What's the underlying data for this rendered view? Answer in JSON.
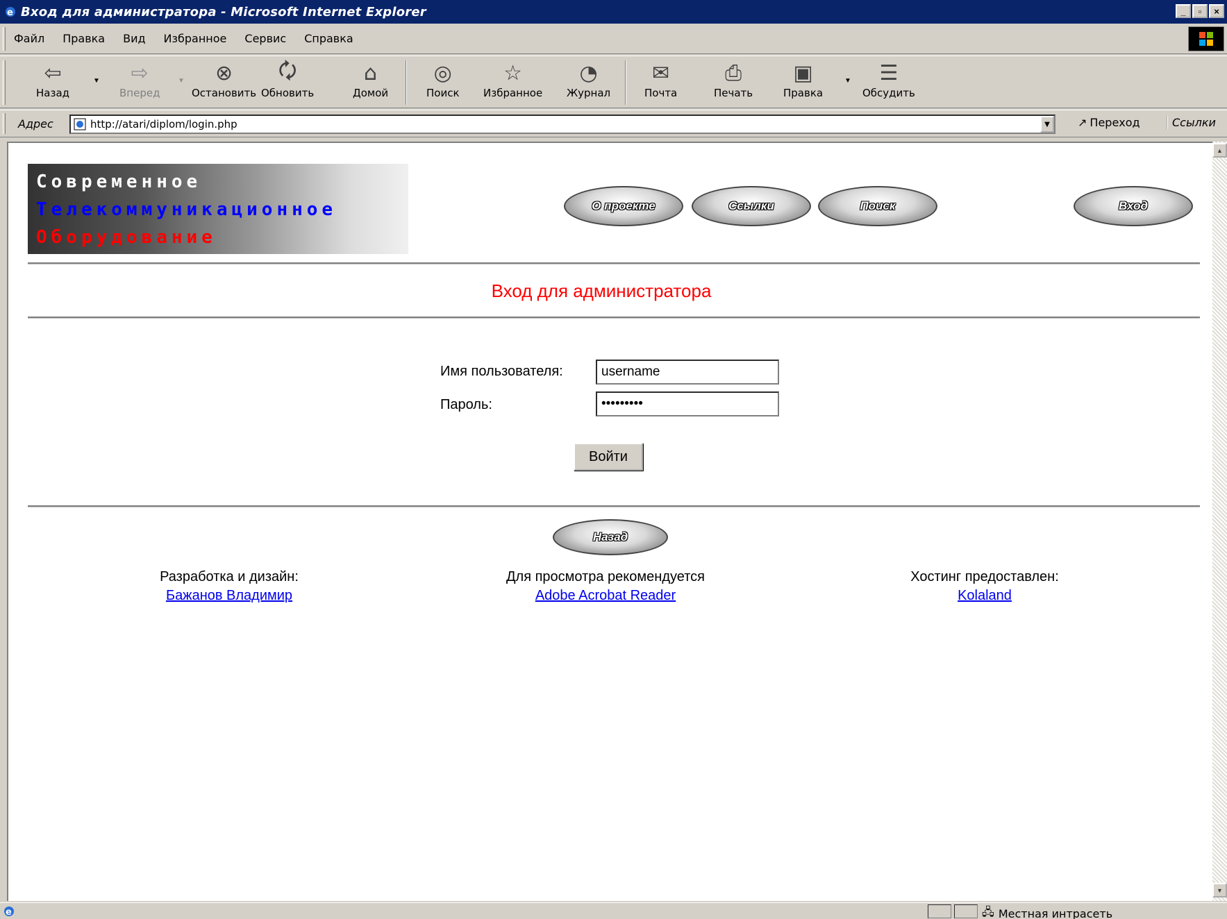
{
  "window": {
    "title": "Вход для администратора - Microsoft Internet Explorer",
    "controls": [
      "minimize",
      "maximize",
      "close"
    ]
  },
  "menu": [
    "Файл",
    "Правка",
    "Вид",
    "Избранное",
    "Сервис",
    "Справка"
  ],
  "toolbar": {
    "back": "Назад",
    "forward": "Вперед",
    "stop": "Остановить",
    "refresh": "Обновить",
    "home": "Домой",
    "search": "Поиск",
    "favorites": "Избранное",
    "history": "Журнал",
    "mail": "Почта",
    "print": "Печать",
    "edit": "Правка",
    "discuss": "Обсудить"
  },
  "address": {
    "label": "Адрес",
    "url": "http://atari/diplom/login.php",
    "go": "Переход",
    "links": "Ссылки"
  },
  "page": {
    "logo": {
      "line1": "Современное",
      "line2": "Телекоммуникационное",
      "line3": "Оборудование"
    },
    "nav": {
      "about": "О проекте",
      "links": "Ссылки",
      "search": "Поиск",
      "login": "Вход"
    },
    "heading": "Вход для администратора",
    "form": {
      "username_label": "Имя пользователя:",
      "username_value": "username",
      "password_label": "Пароль:",
      "password_value": "*********",
      "submit": "Войти"
    },
    "back_button": "Назад",
    "footer": {
      "dev_label": "Разработка и дизайн:",
      "dev_link": "Бажанов Владимир",
      "viewer_label": "Для просмотра рекомендуется",
      "viewer_link": "Adobe Acrobat Reader",
      "hosting_label": "Хостинг предоставлен:",
      "hosting_link": "Kolaland"
    }
  },
  "status": {
    "zone": "Местная интрасеть"
  },
  "colors": {
    "titlebar": "#0a246a",
    "heading": "#ff0000",
    "link": "#0000ee",
    "chrome": "#d4d0c8"
  }
}
